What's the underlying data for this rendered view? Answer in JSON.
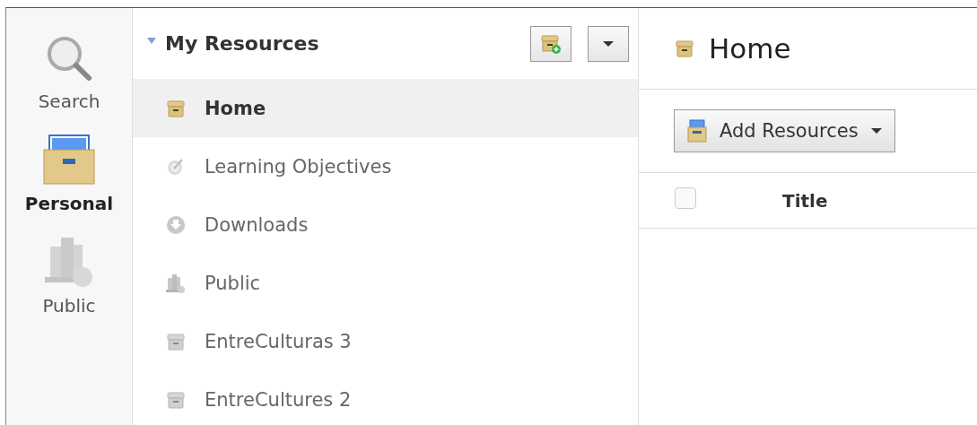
{
  "rail": [
    {
      "label": "Search",
      "kind": "search",
      "selected": false
    },
    {
      "label": "Personal",
      "kind": "personal",
      "selected": true
    },
    {
      "label": "Public",
      "kind": "library",
      "selected": false
    }
  ],
  "tree": {
    "title": "My Resources",
    "expanded": true,
    "items": [
      {
        "label": "Home",
        "kind": "box",
        "selected": true
      },
      {
        "label": "Learning Objectives",
        "kind": "target",
        "selected": false
      },
      {
        "label": "Downloads",
        "kind": "download",
        "selected": false
      },
      {
        "label": "Public",
        "kind": "library",
        "selected": false
      },
      {
        "label": "EntreCulturas 3",
        "kind": "box",
        "selected": false
      },
      {
        "label": "EntreCultures 2",
        "kind": "box",
        "selected": false
      }
    ]
  },
  "main": {
    "title": "Home",
    "button": "Add Resources",
    "table": {
      "select_all": {
        "checked": false
      },
      "columns": [
        "Title"
      ]
    }
  }
}
